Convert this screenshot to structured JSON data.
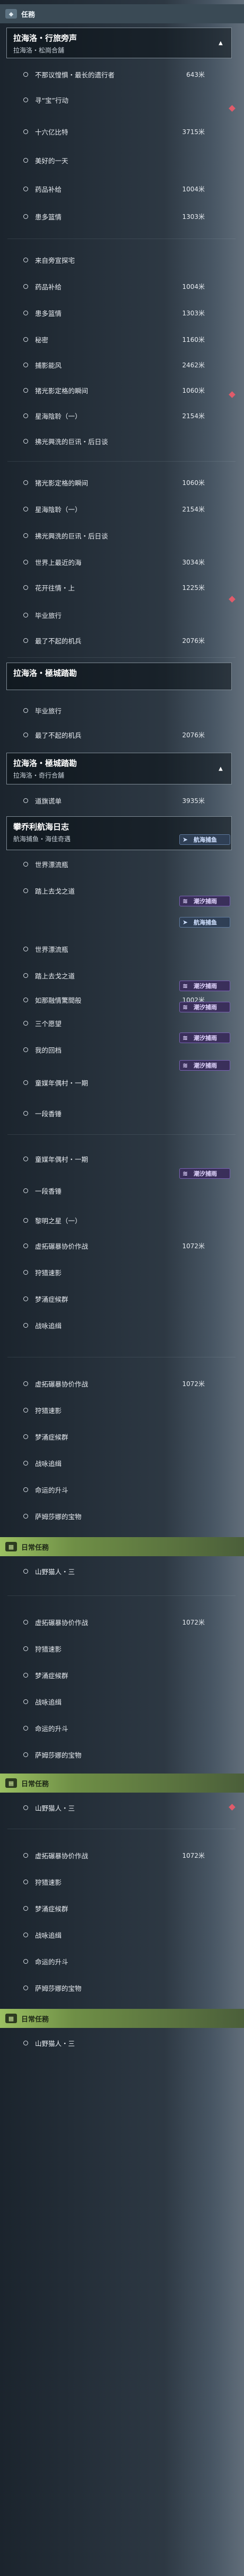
{
  "headers": {
    "side_quests": "任務",
    "daily_quests": "日常任務"
  },
  "quests": {
    "rayuela_guide": "拉海洛・行旅旁声",
    "rayuela_guide_sub": "拉海洛・松崗合舗",
    "rayuela_escort": "拉海洛・極城踏勘",
    "rayuela_escort_sub": "拉海洛・奇行合舗",
    "anchor_log": "攀乔利航海日志",
    "anchor_log_sub": "航海捕鱼・海佳奇遇"
  },
  "tags": {
    "sea": "航海捕鱼",
    "tide": "潮汐捕雨"
  },
  "items": {
    "a1": "不那议惶惧・最长的遗行者",
    "a2": "寻“宝”行动",
    "a3": "十六亿比特",
    "a4": "美好的一天",
    "a5": "药品补给",
    "a6": "患多篮情",
    "b1": "来自旁宣探宅",
    "b2": "药品补给",
    "b3": "患多篮情",
    "b4": "秘密",
    "b5": "捕影能风",
    "b6": "猪光影定格的瞬间",
    "b7": "星海陰聆（一）",
    "b8": "拂光興洗的巨讯・后日谈",
    "c1": "猪光影定格的瞬间",
    "c2": "星海陰聆（一）",
    "c3": "拂光興洗的巨讯・后日谈",
    "c4": "世界上最近的海",
    "c5": "花开往情・上",
    "c6": "毕业旅行",
    "c7": "最了不起的机兵",
    "d1": "毕业旅行",
    "d2": "最了不起的机兵",
    "e1": "道旗谎单",
    "f1": "世界漂流瓶",
    "f2": "踏上去戈之道",
    "f3": "世界漂流瓶",
    "f4": "踏上去戈之道",
    "f5": "如那融情驚間般",
    "f6": "三个愿望",
    "f7": "我的回档",
    "f8": "童媒年偶村・一期",
    "f9": "一段香锤",
    "g1": "童媒年偶村・一期",
    "g2": "一段香锤",
    "g3": "黎明之星（一）",
    "g4": "虚拓碾暴协价作战",
    "g5": "狩猎速影",
    "g6": "梦涌症候群",
    "g7": "战咏追缉",
    "h1": "虚拓碾暴协价作战",
    "h2": "狩猎速影",
    "h3": "梦涌症候群",
    "h4": "战咏追缉",
    "h5": "命运的升斗",
    "h6": "萨姆莎娜的宝物",
    "i1": "山野猫人・三",
    "j1": "虚拓碾暴协价作战",
    "j2": "狩猎速影",
    "j3": "梦涌症候群",
    "j4": "战咏追缉",
    "j5": "命运的升斗",
    "j6": "萨姆莎娜的宝物",
    "k1": "山野猫人・三",
    "l1": "虚拓碾暴协价作战",
    "l2": "狩猎速影",
    "l3": "梦涌症候群",
    "l4": "战咏追缉",
    "l5": "命运的升斗",
    "l6": "萨姆莎娜的宝物",
    "m1": "山野猫人・三"
  },
  "distances": {
    "a1": "643米",
    "a3": "3715米",
    "a5": "1004米",
    "a6": "1303米",
    "b2": "1004米",
    "b3": "1303米",
    "b4": "1160米",
    "b5": "2462米",
    "b6": "1060米",
    "b7": "2154米",
    "c1": "1060米",
    "c2": "2154米",
    "c4": "3034米",
    "c5": "1225米",
    "c7": "2076米",
    "d2": "2076米",
    "e1": "3935米",
    "f5": "1002米",
    "g4": "1072米",
    "h1": "1072米",
    "j1": "1072米",
    "l1": "1072米"
  }
}
